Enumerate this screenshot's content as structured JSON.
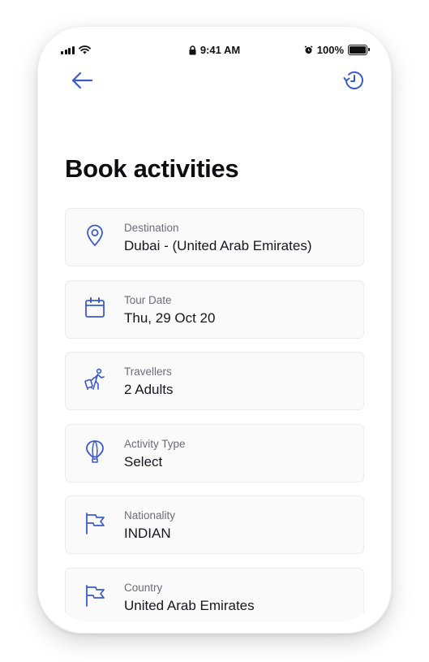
{
  "status_bar": {
    "time": "9:41 AM",
    "battery": "100%"
  },
  "header": {
    "back_icon": "arrow-left-icon",
    "history_icon": "history-icon"
  },
  "page": {
    "title": "Book activities"
  },
  "fields": [
    {
      "label": "Destination",
      "value": "Dubai - (United Arab Emirates)",
      "icon": "location-pin-icon"
    },
    {
      "label": "Tour Date",
      "value": "Thu, 29 Oct 20",
      "icon": "calendar-icon"
    },
    {
      "label": "Travellers",
      "value": "2 Adults",
      "icon": "traveller-icon"
    },
    {
      "label": "Activity Type",
      "value": "Select",
      "icon": "hot-air-balloon-icon"
    },
    {
      "label": "Nationality",
      "value": "INDIAN",
      "icon": "flag-icon"
    },
    {
      "label": "Country",
      "value": "United Arab Emirates",
      "icon": "flag-icon"
    }
  ],
  "colors": {
    "accent": "#3a5bd0",
    "title": "#0d0d12",
    "label": "#6c6c78",
    "value": "#16161d",
    "card_bg": "#fbfafb",
    "card_border": "#ececef"
  }
}
